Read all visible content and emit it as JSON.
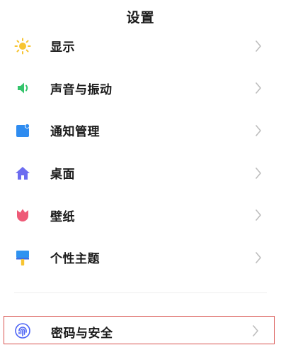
{
  "header": {
    "title": "设置"
  },
  "settings": {
    "items": [
      {
        "label": "显示",
        "icon": "sun-icon",
        "color": "#F7C431"
      },
      {
        "label": "声音与振动",
        "icon": "speaker-icon",
        "color": "#35C46C"
      },
      {
        "label": "通知管理",
        "icon": "notification-icon",
        "color": "#2F8CF0"
      },
      {
        "label": "桌面",
        "icon": "home-icon",
        "color": "#6C6CF0"
      },
      {
        "label": "壁纸",
        "icon": "tulip-icon",
        "color": "#EE5A77"
      },
      {
        "label": "个性主题",
        "icon": "brush-icon",
        "color": "#2F93F0"
      }
    ]
  },
  "security": {
    "label": "密码与安全",
    "icon": "fingerprint-icon",
    "color": "#4C63F5",
    "highlight_color": "#D9534F"
  },
  "colors": {
    "chevron": "#BDBDBD",
    "text": "#1A1A1A",
    "divider": "#EEEEEE"
  }
}
